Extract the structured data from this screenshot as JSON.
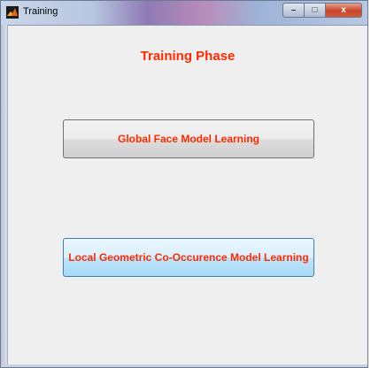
{
  "window": {
    "title": "Training",
    "controls": {
      "minimize": "–",
      "maximize": "□",
      "close": "x"
    }
  },
  "main": {
    "phase_title": "Training Phase",
    "buttons": {
      "global": "Global Face Model Learning",
      "local": "Local Geometric Co-Occurence Model Learning"
    }
  },
  "colors": {
    "label_text": "#ff2a00",
    "background": "#efefef",
    "hover_button": "#bee6fd"
  },
  "icons": {
    "app": "matlab-icon",
    "minimize": "minimize-icon",
    "maximize": "maximize-icon",
    "close": "close-icon"
  }
}
